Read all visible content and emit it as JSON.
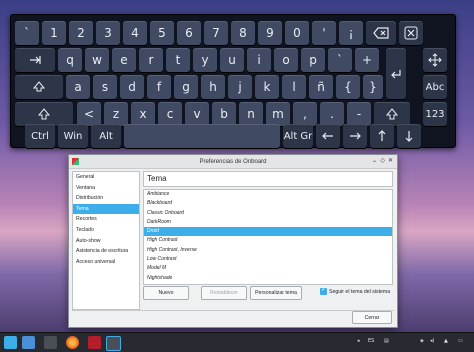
{
  "keyboard": {
    "row1": [
      "`",
      "1",
      "2",
      "3",
      "4",
      "5",
      "6",
      "7",
      "8",
      "9",
      "0",
      "'",
      "¡"
    ],
    "row2": [
      "q",
      "w",
      "e",
      "r",
      "t",
      "y",
      "u",
      "i",
      "o",
      "p",
      "`",
      "+"
    ],
    "row3": [
      "a",
      "s",
      "d",
      "f",
      "g",
      "h",
      "j",
      "k",
      "l",
      "ñ",
      "{",
      "}"
    ],
    "row4": [
      "<",
      "z",
      "x",
      "c",
      "v",
      "b",
      "n",
      "m",
      ",",
      ".",
      "-"
    ],
    "abc_label": "Abc",
    "num_label": "123",
    "ctrl_label": "Ctrl",
    "win_label": "Win",
    "alt_label": "Alt",
    "altgr_label": "Alt Gr"
  },
  "prefs": {
    "title": "Preferencias de Onboard",
    "sidebar": [
      "General",
      "Ventana",
      "Distribución",
      "Tema",
      "Recortes",
      "Teclado",
      "Auto-show",
      "Asistencia de escritura",
      "Acceso universal"
    ],
    "selected_section": "Tema",
    "section_title": "Tema",
    "themes": [
      "Ambiance",
      "Blackboard",
      "Classic Onboard",
      "DarkRoom",
      "Droid",
      "High Contrast",
      "High Contrast, Inverse",
      "Low Contrast",
      "Model M",
      "Nightshade"
    ],
    "selected_theme": "Droid",
    "btn_new": "Nuevo",
    "btn_reset": "Restablecer",
    "btn_customize": "Personalizar tema",
    "follow_system_label": "Seguir el tema del sistema",
    "follow_system_checked": true,
    "close_label": "Cerrar"
  },
  "taskbar": {
    "lang": "ES"
  },
  "colors": {
    "accent": "#3daee9",
    "key_bg": "#404b63",
    "keyboard_bg": "#0f1420"
  }
}
